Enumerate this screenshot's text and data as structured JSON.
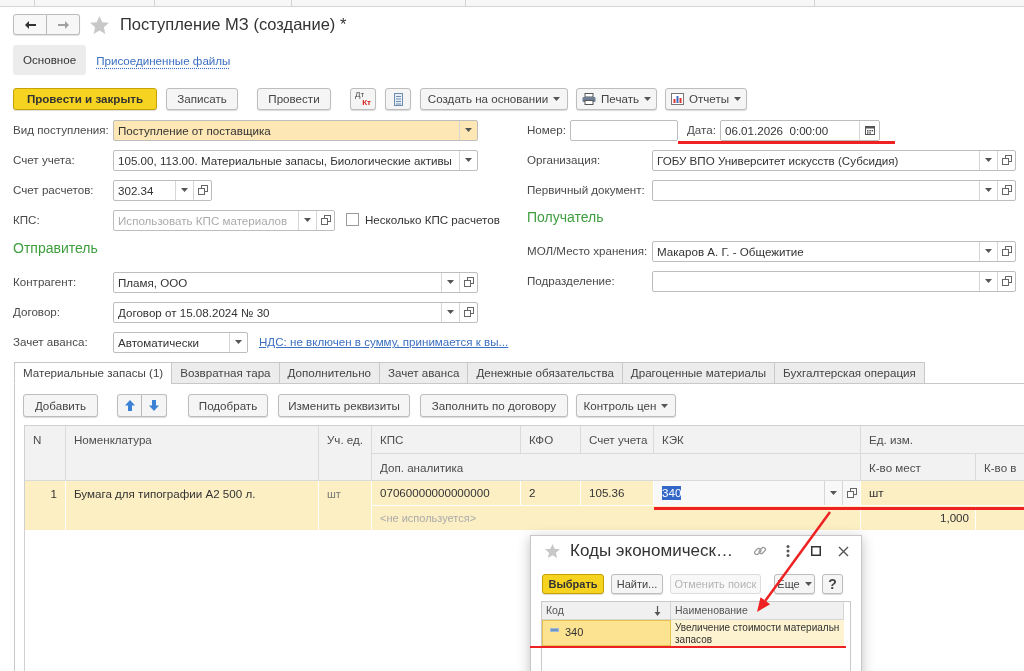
{
  "header": {
    "title": "Поступление МЗ (создание) *"
  },
  "form_tabs": [
    {
      "label": "Основное",
      "selected": true
    },
    {
      "label": "Присоединенные файлы",
      "selected": false
    }
  ],
  "toolbar": [
    {
      "kind": "default",
      "label": "Провести и закрыть"
    },
    {
      "kind": "plain",
      "label": "Записать"
    },
    {
      "kind": "plain",
      "label": "Провести"
    },
    {
      "kind": "dtkt",
      "top": "Дт",
      "bottom": "Кт"
    },
    {
      "kind": "list"
    },
    {
      "kind": "menu",
      "label": "Создать на основании"
    },
    {
      "kind": "print",
      "label": "Печать"
    },
    {
      "kind": "reports",
      "label": "Отчеты"
    }
  ],
  "left_fields": [
    {
      "kind": "select",
      "label": "Вид поступления:",
      "value": "Поступление от поставщика",
      "highlighted": true
    },
    {
      "kind": "select",
      "label": "Счет учета:",
      "value": "105.00, 113.00. Материальные запасы, Биологические активы",
      "highlighted": false
    },
    {
      "kind": "select_open",
      "label": "Счет расчетов:",
      "value": "302.34",
      "highlighted": false
    },
    {
      "kind": "select_open",
      "label": "КПС:",
      "placeholder": "Использовать КПС материалов",
      "highlighted": false,
      "checkbox": {
        "label": "Несколько КПС расчетов",
        "checked": false
      }
    },
    {
      "kind": "heading",
      "text": "Отправитель"
    },
    {
      "kind": "select_open",
      "label": "Контрагент:",
      "value": "Пламя, ООО",
      "highlighted": false
    },
    {
      "kind": "select_open",
      "label": "Договор:",
      "value": "Договор от 15.08.2024 № 30",
      "highlighted": false
    },
    {
      "kind": "select",
      "label": "Зачет аванса:",
      "value": "Автоматически",
      "highlighted": false,
      "link": "НДС: не включен в сумму, принимается к вы..."
    }
  ],
  "number_field": {
    "label": "Номер:"
  },
  "date_field": {
    "label": "Дата:",
    "value": "06.01.2026  0:00:00",
    "annotated": true
  },
  "right_fields": [
    {
      "kind": "select_open",
      "label": "Организация:",
      "value": "ГОБУ ВПО Университет искусств (Субсидия)",
      "highlighted": false
    },
    {
      "kind": "select_open",
      "label": "Первичный документ:",
      "highlighted": false
    },
    {
      "kind": "heading",
      "text": "Получатель"
    },
    {
      "kind": "select_open",
      "label": "МОЛ/Место хранения:",
      "value": "Макаров А. Г. - Общежитие",
      "highlighted": false
    },
    {
      "kind": "select_open",
      "label": "Подразделение:",
      "highlighted": false
    }
  ],
  "document_tabs": [
    {
      "label": "Материальные запасы (1)",
      "selected": true
    },
    {
      "label": "Возвратная тара",
      "selected": false
    },
    {
      "label": "Дополнительно",
      "selected": false
    },
    {
      "label": "Зачет аванса",
      "selected": false
    },
    {
      "label": "Денежные обязательства",
      "selected": false
    },
    {
      "label": "Драгоценные материалы",
      "selected": false
    },
    {
      "label": "Бухгалтерская операция",
      "selected": false
    }
  ],
  "table_toolbar": [
    {
      "kind": "plain",
      "label": "Добавить"
    },
    {
      "kind": "updown"
    },
    {
      "kind": "plain",
      "label": "Подобрать"
    },
    {
      "kind": "plain",
      "label": "Изменить реквизиты"
    },
    {
      "kind": "plain",
      "label": "Заполнить по договору"
    },
    {
      "kind": "menu",
      "label": "Контроль цен"
    }
  ],
  "table": {
    "header_rows": [
      [
        "N",
        "Номенклатура",
        "Уч. ед.",
        "КПС",
        "КФО",
        "Счет учета",
        "КЭК",
        "Ед. изм."
      ],
      [
        "Доп. аналитика",
        "К-во мест",
        "К-во в"
      ]
    ],
    "rows": [
      {
        "number": "1",
        "name": "Бумага для типографии А2 500 л.",
        "unit": "шт",
        "kps": "07060000000000000",
        "kfo": "2",
        "account": "105.36",
        "kek": "340",
        "kek_editing": true,
        "measure": "шт",
        "analytics": "<не используется>",
        "places": "1,000",
        "selected": true,
        "annotated": true
      }
    ]
  },
  "popup": {
    "title": "Коды экономическ…",
    "buttons": [
      {
        "kind": "default",
        "label": "Выбрать",
        "disabled": false
      },
      {
        "kind": "plain",
        "label": "Найти...",
        "disabled": false
      },
      {
        "kind": "plain",
        "label": "Отменить поиск",
        "disabled": true
      },
      {
        "kind": "menu",
        "label": "Еще",
        "disabled": false
      },
      {
        "kind": "help",
        "label": "?",
        "disabled": false
      }
    ],
    "columns": [
      {
        "label": "Код",
        "sorted": true
      },
      {
        "label": "Наименование",
        "sorted": false
      }
    ],
    "rows": [
      {
        "code": "340",
        "name_lines": [
          "Увеличение стоимости материальн",
          "запасов"
        ],
        "selected": true,
        "annotated": true
      }
    ]
  }
}
